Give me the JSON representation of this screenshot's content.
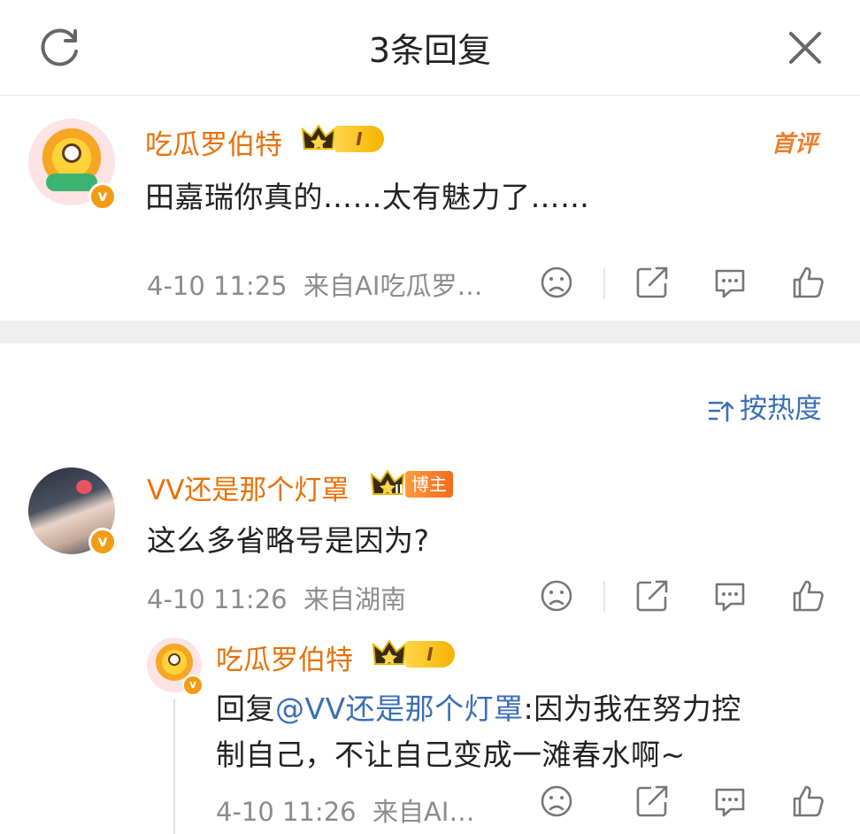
{
  "header": {
    "title": "3条回复",
    "refresh_icon": "refresh-icon",
    "close_icon": "close-icon"
  },
  "main_comment": {
    "username": "吃瓜罗伯特",
    "level_badge": "I",
    "tag": "首评",
    "text": "田嘉瑞你真的……太有魅力了……",
    "time": "4-10 11:25",
    "source": "来自AI吃瓜罗…"
  },
  "sort": {
    "label": "按热度",
    "icon": "sort-icon"
  },
  "replies": [
    {
      "username": "VV还是那个灯罩",
      "level_badge": "III",
      "role_badge": "博主",
      "text": "这么多省略号是因为?",
      "time": "4-10 11:26",
      "source": "来自湖南"
    },
    {
      "username": "吃瓜罗伯特",
      "level_badge": "I",
      "reply_prefix": "回复",
      "mention": "@VV还是那个灯罩",
      "text_line1": ":因为我在努力控",
      "text_line2": "制自己，不让自己变成一滩春水啊~",
      "time": "4-10 11:26",
      "source": "来自AI…"
    }
  ],
  "colors": {
    "username": "#e8710a",
    "link": "#3b6fb6",
    "meta": "#8c8c8c",
    "verified": "#f39c12"
  }
}
